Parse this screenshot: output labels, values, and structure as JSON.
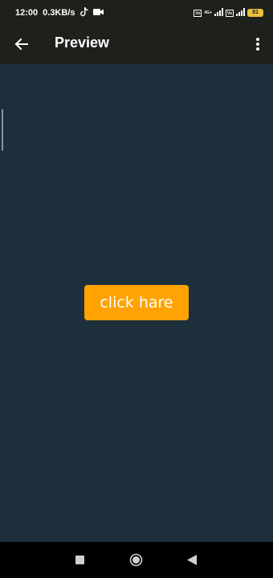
{
  "status_bar": {
    "time": "12:00",
    "speed": "0.3KB/s",
    "sim1_label": "Vo",
    "sim2_label": "Vo",
    "network_label": "4G+",
    "battery": "81"
  },
  "app_bar": {
    "title": "Preview"
  },
  "main": {
    "button_label": "click hare"
  },
  "colors": {
    "bar_background": "#1e201c",
    "content_background": "#1c2f3b",
    "button_background": "#ffa304",
    "battery": "#e8c13a"
  },
  "icons": {
    "back": "arrow-left-icon",
    "overflow": "more-vert-icon",
    "tiktok": "tiktok-icon",
    "video": "video-camera-icon",
    "recents": "square-icon",
    "home": "circle-icon",
    "nav_back": "triangle-left-icon"
  }
}
